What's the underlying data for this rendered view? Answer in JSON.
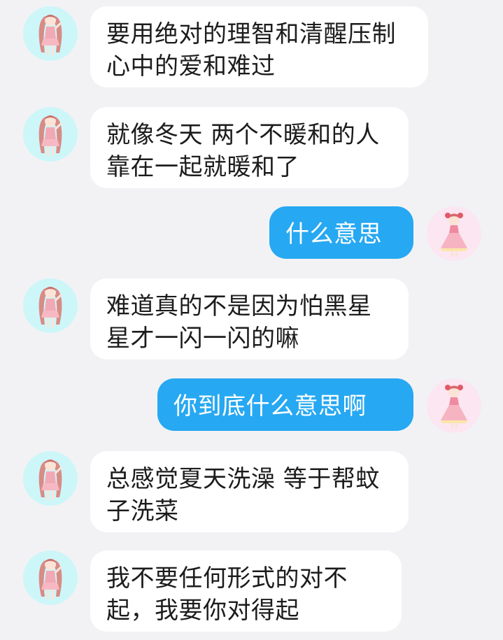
{
  "messages": [
    {
      "side": "left",
      "avatar_icon": "twin-tail-girl-avatar-icon",
      "text": "要用绝对的理智和清醒压制心中的爱和难过"
    },
    {
      "side": "left",
      "avatar_icon": "twin-tail-girl-avatar-icon",
      "text": "就像冬天 两个不暖和的人靠在一起就暖和了"
    },
    {
      "side": "right",
      "avatar_icon": "lolita-dress-girl-avatar-icon",
      "text": "什么意思"
    },
    {
      "side": "left",
      "avatar_icon": "twin-tail-girl-avatar-icon",
      "text": "难道真的不是因为怕黑星星才一闪一闪的嘛"
    },
    {
      "side": "right",
      "avatar_icon": "lolita-dress-girl-avatar-icon",
      "text": "你到底什么意思啊"
    },
    {
      "side": "left",
      "avatar_icon": "twin-tail-girl-avatar-icon",
      "text": "总感觉夏天洗澡 等于帮蚊子洗菜"
    },
    {
      "side": "left",
      "avatar_icon": "twin-tail-girl-avatar-icon",
      "text": "我不要任何形式的对不起，我要你对得起"
    }
  ],
  "colors": {
    "background": "#f2f2f4",
    "incoming_bubble": "#ffffff",
    "outgoing_bubble": "#27a8f2",
    "incoming_avatar_bg": "#cdf6f9",
    "outgoing_avatar_bg": "#fbe6f1"
  }
}
